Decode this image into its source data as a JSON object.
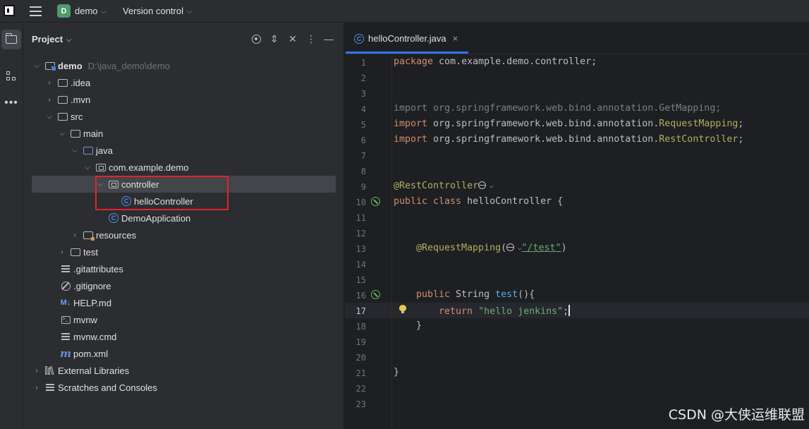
{
  "titlebar": {
    "project_badge": "D",
    "project_name": "demo",
    "version_control": "Version control"
  },
  "project_panel": {
    "title": "Project",
    "tree": [
      {
        "label": "demo",
        "path": "D:\\java_demo\\demo"
      },
      {
        "label": ".idea"
      },
      {
        "label": ".mvn"
      },
      {
        "label": "src"
      },
      {
        "label": "main"
      },
      {
        "label": "java"
      },
      {
        "label": "com.example.demo"
      },
      {
        "label": "controller"
      },
      {
        "label": "helloController"
      },
      {
        "label": "DemoApplication"
      },
      {
        "label": "resources"
      },
      {
        "label": "test"
      },
      {
        "label": ".gitattributes"
      },
      {
        "label": ".gitignore"
      },
      {
        "label": "HELP.md"
      },
      {
        "label": "mvnw"
      },
      {
        "label": "mvnw.cmd"
      },
      {
        "label": "pom.xml"
      },
      {
        "label": "External Libraries"
      },
      {
        "label": "Scratches and Consoles"
      }
    ],
    "highlight_color": "#e5232b"
  },
  "editor": {
    "tab_label": "helloController.java",
    "tab_close": "×",
    "current_line": 17,
    "lines": [
      "1",
      "2",
      "3",
      "4",
      "5",
      "6",
      "7",
      "8",
      "9",
      "10",
      "11",
      "12",
      "13",
      "14",
      "15",
      "16",
      "17",
      "18",
      "19",
      "20",
      "21",
      "22",
      "23"
    ],
    "code": {
      "l1_kw": "package",
      "l1_rest": " com.example.demo.controller;",
      "l4_kw": "import",
      "l4_rest": " org.springframework.web.bind.annotation.GetMapping;",
      "l5_kw": "import",
      "l5_pkg": " org.springframework.web.bind.annotation.",
      "l5_cls": "RequestMapping",
      "l5_end": ";",
      "l6_kw": "import",
      "l6_pkg": " org.springframework.web.bind.annotation.",
      "l6_cls": "RestController",
      "l6_end": ";",
      "l9_ann": "@RestController",
      "l10_kw": "public class",
      "l10_rest": " helloController {",
      "l13_ann": "@RequestMapping",
      "l13_open": "(",
      "l13_str": "\"/test\"",
      "l13_close": ")",
      "l16_kw": "public",
      "l16_type": " String ",
      "l16_fn": "test",
      "l16_rest": "(){",
      "l17_kw": "return",
      "l17_str": "\"hello jenkins\"",
      "l17_end": ";",
      "l18": "}",
      "l21": "}"
    }
  },
  "watermark": "CSDN @大侠运维联盟",
  "colors": {
    "accent": "#3574f0",
    "keyword": "#cf8e6d",
    "annotation": "#b3ae60",
    "string": "#6aab73",
    "function": "#56a8f5"
  }
}
